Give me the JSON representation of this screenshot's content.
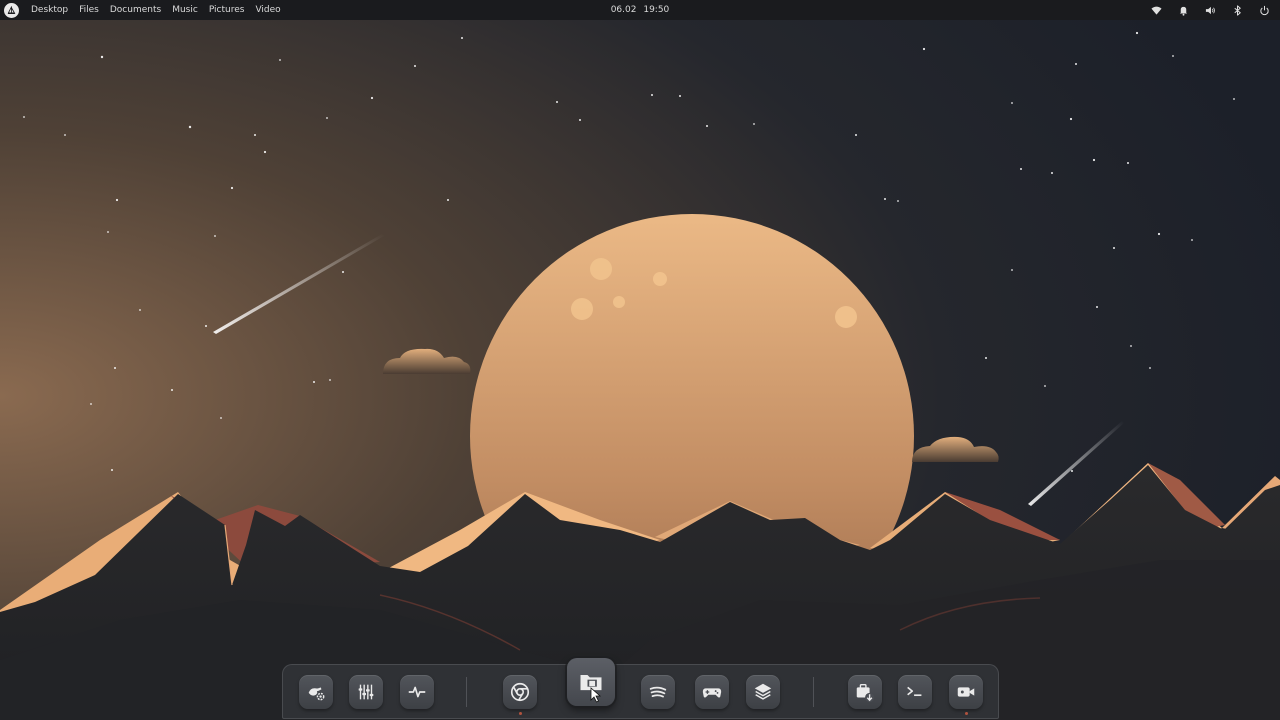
{
  "topbar": {
    "menu": [
      "Desktop",
      "Files",
      "Documents",
      "Music",
      "Pictures",
      "Video"
    ],
    "date": "06.02",
    "time": "19:50",
    "tray_icons": [
      "wifi-icon",
      "bell-icon",
      "volume-icon",
      "bluetooth-icon",
      "power-icon"
    ]
  },
  "dock": {
    "items": [
      {
        "icon": "system-settings-icon",
        "running": false
      },
      {
        "icon": "mixer-sliders-icon",
        "running": false
      },
      {
        "icon": "system-monitor-icon",
        "running": false
      },
      {
        "icon": "chrome-browser-icon",
        "running": true
      },
      {
        "icon": "file-manager-icon",
        "running": false,
        "active": true
      },
      {
        "icon": "spotify-icon",
        "running": false
      },
      {
        "icon": "gamepad-icon",
        "running": false
      },
      {
        "icon": "layers-stack-icon",
        "running": false
      },
      {
        "icon": "software-install-icon",
        "running": false
      },
      {
        "icon": "terminal-icon",
        "running": false
      },
      {
        "icon": "video-camera-icon",
        "running": true
      }
    ]
  },
  "colors": {
    "topbar_bg": "#1a1b1e",
    "dock_bg": "#303236",
    "moon": "#d29a6a",
    "sky_left": "#7d6049",
    "sky_right": "#202430",
    "mountain": "#2b2b2d",
    "mountain_highlight": "#f0b882",
    "running_indicator": "#b0533e"
  }
}
